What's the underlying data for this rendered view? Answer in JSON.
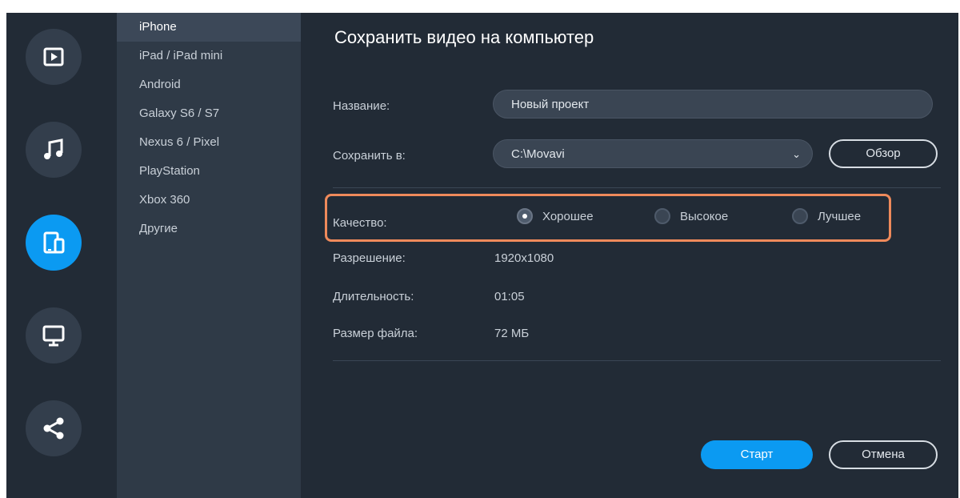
{
  "sidebar": {
    "icons": [
      "video-icon",
      "music-icon",
      "devices-icon",
      "monitor-icon",
      "share-icon"
    ],
    "active_index": 2
  },
  "devices": {
    "items": [
      "iPhone",
      "iPad / iPad mini",
      "Android",
      "Galaxy S6 / S7",
      "Nexus 6 / Pixel",
      "PlayStation",
      "Xbox 360",
      "Другие"
    ],
    "selected": "iPhone"
  },
  "main": {
    "title": "Сохранить видео на компьютер",
    "name_label": "Название:",
    "name_value": "Новый проект",
    "save_to_label": "Сохранить в:",
    "save_to_value": "C:\\Movavi",
    "browse_label": "Обзор",
    "quality_label": "Качество:",
    "quality_options": [
      "Хорошее",
      "Высокое",
      "Лучшее"
    ],
    "quality_selected": "Хорошее",
    "resolution_label": "Разрешение:",
    "resolution_value": "1920x1080",
    "duration_label": "Длительность:",
    "duration_value": "01:05",
    "filesize_label": "Размер файла:",
    "filesize_value": "72 МБ",
    "start_label": "Старт",
    "cancel_label": "Отмена"
  },
  "colors": {
    "accent": "#0b9af2",
    "highlight": "#ef8a5b",
    "background": "#222b36",
    "panel": "#2f3a47"
  }
}
